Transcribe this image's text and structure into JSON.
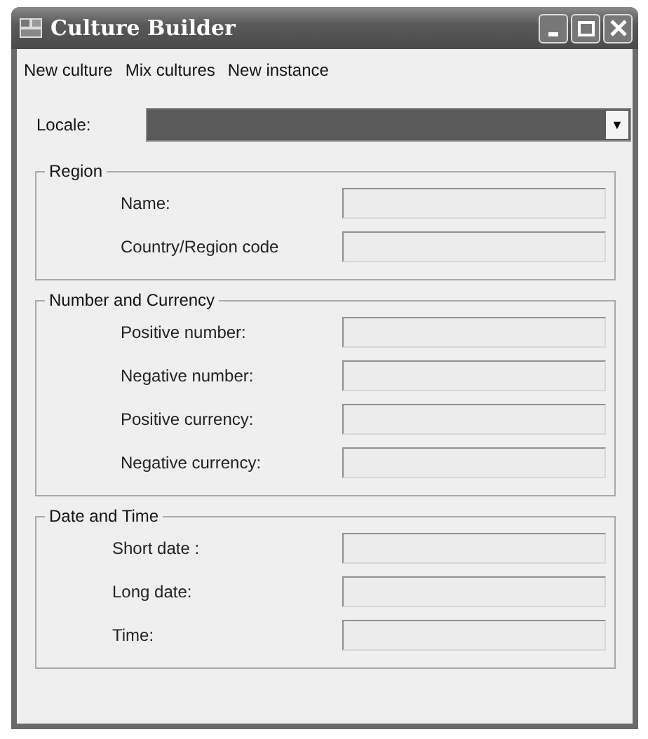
{
  "window": {
    "title": "Culture Builder"
  },
  "menu": [
    "New culture",
    "Mix cultures",
    "New instance"
  ],
  "locale": {
    "label": "Locale:",
    "arrow": "▼"
  },
  "groups": [
    {
      "title": "Region",
      "rows": [
        {
          "label": "Name:"
        },
        {
          "label": "Country/Region code"
        }
      ]
    },
    {
      "title": "Number and Currency",
      "rows": [
        {
          "label": "Positive number:"
        },
        {
          "label": "Negative number:"
        },
        {
          "label": "Positive currency:"
        },
        {
          "label": "Negative currency:"
        }
      ]
    },
    {
      "title": "Date and Time",
      "rows": [
        {
          "label": "Short date :"
        },
        {
          "label": "Long date:"
        },
        {
          "label": "Time:"
        }
      ]
    }
  ]
}
